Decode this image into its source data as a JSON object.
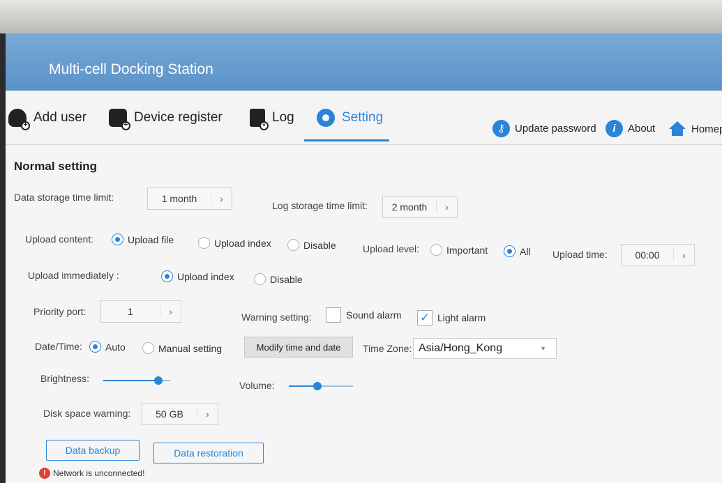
{
  "app": {
    "title": "Multi-cell Docking Station"
  },
  "nav": {
    "items": [
      {
        "label": "Add user",
        "icon": "add-user-icon"
      },
      {
        "label": "Device register",
        "icon": "device-register-icon"
      },
      {
        "label": "Log",
        "icon": "log-icon"
      },
      {
        "label": "Setting",
        "icon": "gear-icon"
      }
    ],
    "active": "Setting",
    "right": [
      {
        "label": "Update password",
        "icon": "key-icon",
        "glyph": "⚷"
      },
      {
        "label": "About",
        "icon": "info-icon",
        "glyph": "i"
      },
      {
        "label": "Homep",
        "icon": "home-icon"
      }
    ]
  },
  "settings": {
    "section_title": "Normal setting",
    "data_storage": {
      "label": "Data storage time limit:",
      "value": "1 month"
    },
    "log_storage": {
      "label": "Log storage time limit:",
      "value": "2 month"
    },
    "upload_content": {
      "label": "Upload content:",
      "options": [
        "Upload file",
        "Upload index",
        "Disable"
      ],
      "selected": "Upload file"
    },
    "upload_level": {
      "label": "Upload level:",
      "options": [
        "Important",
        "All"
      ],
      "selected": "All"
    },
    "upload_time": {
      "label": "Upload time:",
      "value": "00:00"
    },
    "upload_immediately": {
      "label": "Upload immediately :",
      "options": [
        "Upload index",
        "Disable"
      ],
      "selected": "Upload index"
    },
    "priority_port": {
      "label": "Priority port:",
      "value": "1"
    },
    "warning": {
      "label": "Warning setting:",
      "sound_alarm": {
        "label": "Sound alarm",
        "checked": false
      },
      "light_alarm": {
        "label": "Light alarm",
        "checked": true
      }
    },
    "date_time": {
      "label": "Date/Time:",
      "options": [
        "Auto",
        "Manual setting"
      ],
      "selected": "Auto",
      "modify_button": "Modify time and date"
    },
    "time_zone": {
      "label": "Time Zone:",
      "value": "Asia/Hong_Kong"
    },
    "brightness": {
      "label": "Brightness:",
      "level": 0.82
    },
    "volume": {
      "label": "Volume:",
      "level": 0.45
    },
    "disk_warning": {
      "label": "Disk space warning:",
      "value": "50 GB"
    },
    "buttons": {
      "backup": "Data backup",
      "restore": "Data restoration"
    }
  },
  "status": {
    "text": "Network is unconnected!"
  },
  "colors": {
    "accent": "#2a84d8",
    "header": "#5b92c8"
  }
}
